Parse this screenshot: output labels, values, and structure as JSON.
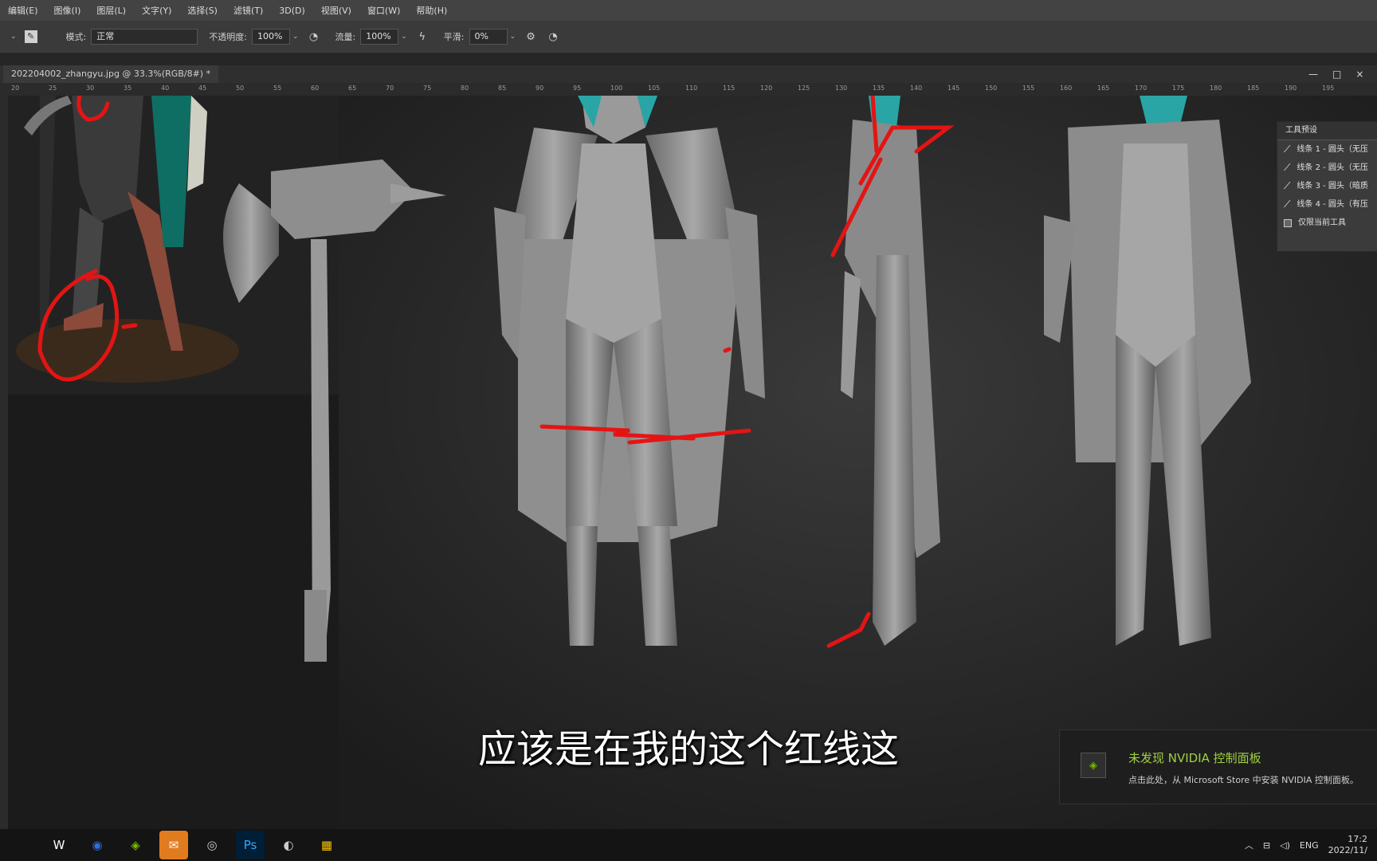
{
  "menu": [
    "编辑(E)",
    "图像(I)",
    "图层(L)",
    "文字(Y)",
    "选择(S)",
    "滤镜(T)",
    "3D(D)",
    "视图(V)",
    "窗口(W)",
    "帮助(H)"
  ],
  "options": {
    "mode_label": "模式:",
    "mode_value": "正常",
    "opacity_label": "不透明度:",
    "opacity_value": "100%",
    "flow_label": "流量:",
    "flow_value": "100%",
    "smooth_label": "平滑:",
    "smooth_value": "0%"
  },
  "document": {
    "tab_title": "202204002_zhangyu.jpg @ 33.3%(RGB/8#) *"
  },
  "window_controls": {
    "minimize": "—",
    "restore": "□",
    "close": "×"
  },
  "ruler_marks": [
    "20",
    "25",
    "30",
    "35",
    "40",
    "45",
    "50",
    "55",
    "60",
    "65",
    "70",
    "75",
    "80",
    "85",
    "90",
    "95",
    "100",
    "105",
    "110",
    "115",
    "120",
    "125",
    "130",
    "135",
    "140",
    "145",
    "150",
    "155",
    "160",
    "165",
    "170",
    "175",
    "180",
    "185",
    "190",
    "195"
  ],
  "tool_presets": {
    "title": "工具预设",
    "items": [
      "线条 1 - 圆头（无压",
      "线条 2 - 圆头（无压",
      "线条 3 - 圆头（暗质",
      "线条 4 - 圆头（有压"
    ],
    "current_tool_only": "仅限当前工具"
  },
  "subtitle": "应该是在我的这个红线这",
  "notification": {
    "title": "未发现 NVIDIA 控制面板",
    "body": "点击此处，从 Microsoft Store 中安装 NVIDIA 控制面板。"
  },
  "taskbar": {
    "apps": [
      {
        "icon": "w-icon",
        "glyph": "W",
        "color": "#ffffff"
      },
      {
        "icon": "browser-icon",
        "glyph": "◉",
        "color": "#2d6fd6"
      },
      {
        "icon": "nvidia-icon",
        "glyph": "◈",
        "color": "#76b900"
      },
      {
        "icon": "wechat-icon",
        "glyph": "✉",
        "color": "#ffffff"
      },
      {
        "icon": "recorder-icon",
        "glyph": "◎",
        "color": "#cccccc"
      },
      {
        "icon": "photoshop-icon",
        "glyph": "Ps",
        "color": "#31a8ff"
      },
      {
        "icon": "camera-icon",
        "glyph": "◐",
        "color": "#cccccc"
      },
      {
        "icon": "paint-icon",
        "glyph": "▦",
        "color": "#f5c400"
      }
    ],
    "tray_lang": "ENG",
    "time": "17:2",
    "date": "2022/11/"
  }
}
